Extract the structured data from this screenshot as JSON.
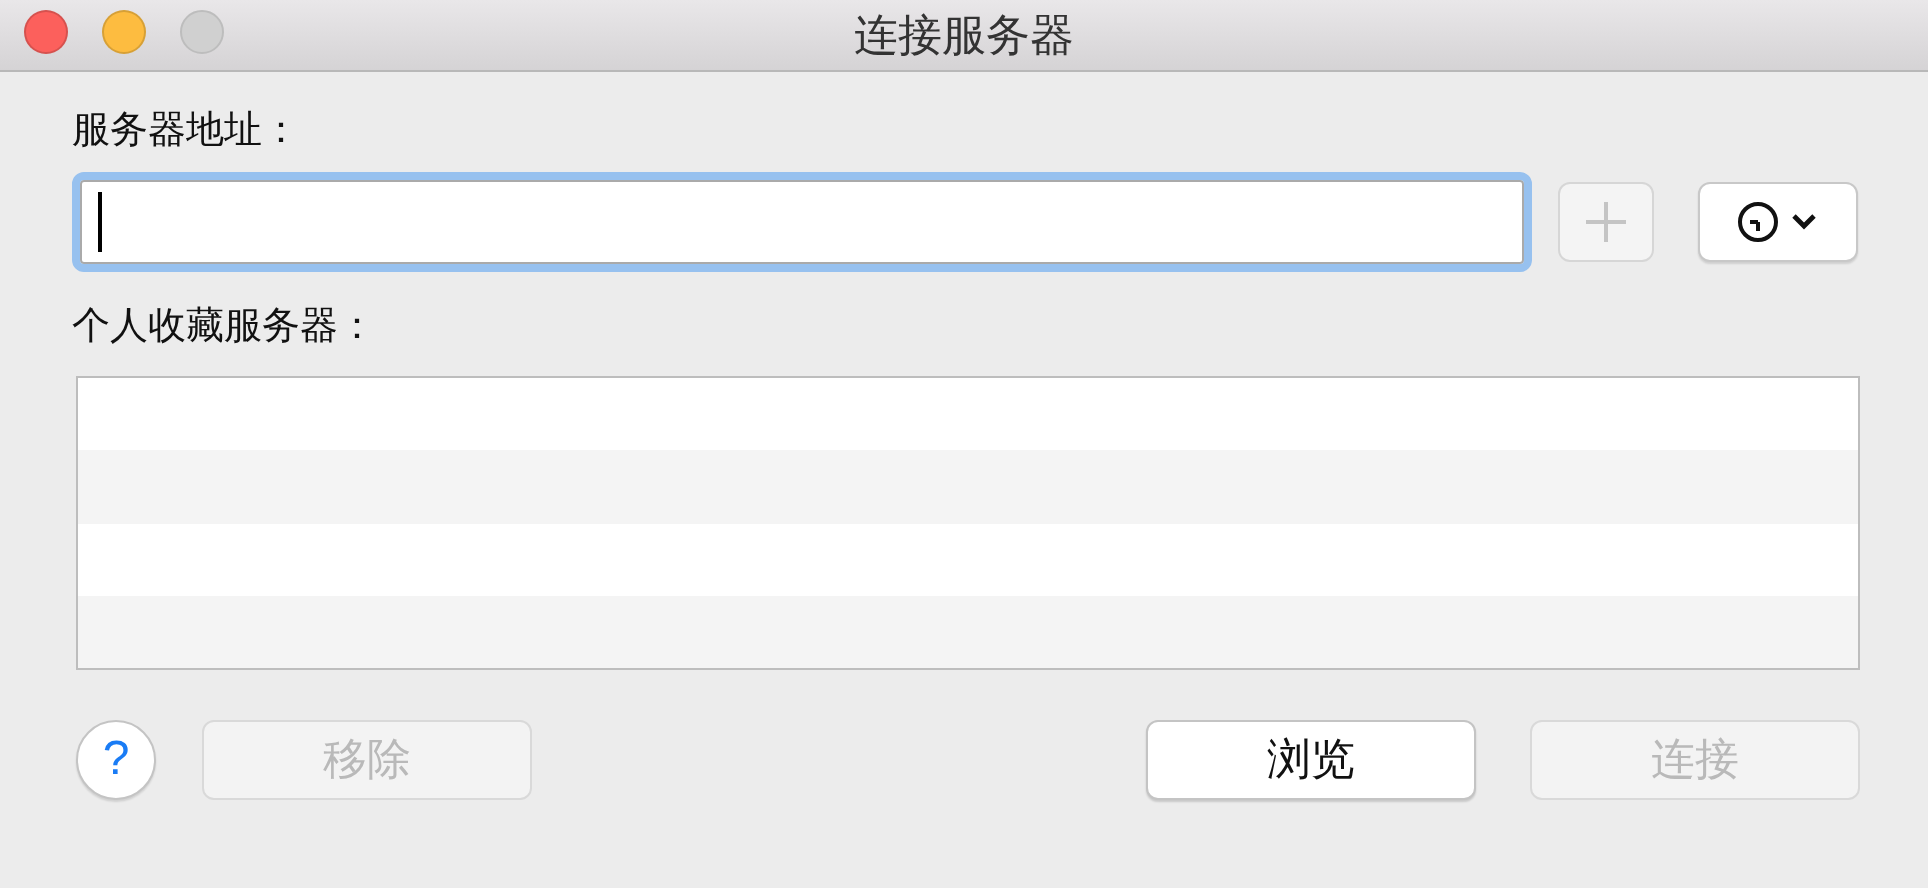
{
  "window": {
    "title": "连接服务器",
    "controls": [
      {
        "kind": "close",
        "disabled": false
      },
      {
        "kind": "minimize",
        "disabled": false
      },
      {
        "kind": "zoom",
        "disabled": true
      }
    ]
  },
  "address": {
    "label": "服务器地址：",
    "focused": true,
    "add_disabled": true
  },
  "favorites": {
    "label": "个人收藏服务器："
  },
  "help": {
    "label": "?"
  },
  "left_buttons": [
    {
      "label": "移除",
      "disabled": true
    }
  ],
  "right_buttons": [
    {
      "label": "浏览",
      "disabled": false
    },
    {
      "label": "连接",
      "disabled": true
    }
  ]
}
